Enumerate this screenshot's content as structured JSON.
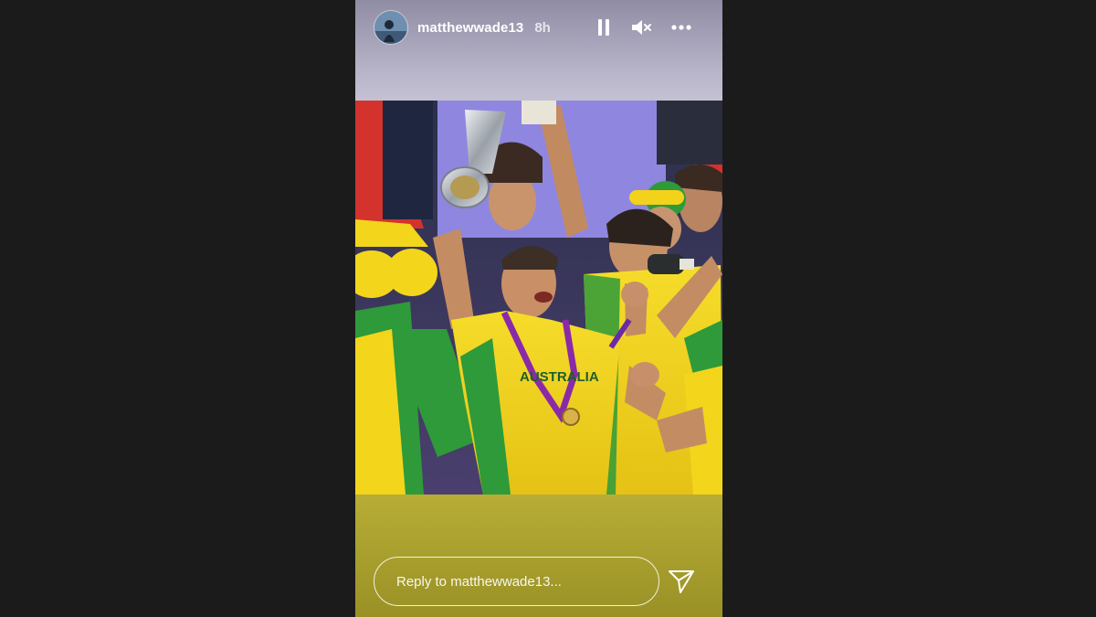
{
  "story": {
    "username": "matthewwade13",
    "time_ago": "8h",
    "photo_jersey_text": "AUSTRALIA",
    "controls": {
      "pause_icon": "pause-icon",
      "mute_icon": "speaker-muted-icon",
      "more_icon": "more-horizontal-icon"
    },
    "reply": {
      "placeholder": "Reply to matthewwade13...",
      "value": "",
      "send_icon": "paper-plane-icon"
    }
  },
  "colors": {
    "background": "#1b1b1b",
    "jersey_yellow": "#f3d51c",
    "jersey_green": "#2e9a3a",
    "bottom_gradient": "#a89f2e"
  }
}
